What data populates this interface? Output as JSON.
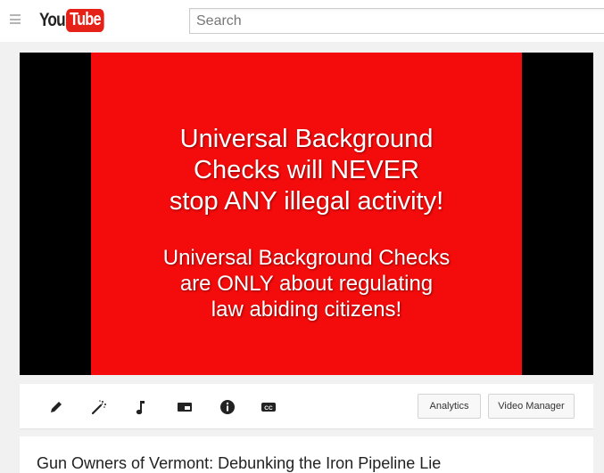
{
  "masthead": {
    "logo_you": "You",
    "logo_tube": "Tube",
    "search_placeholder": "Search"
  },
  "player": {
    "headline_lines": [
      "Universal Background",
      "Checks will NEVER",
      "stop ANY illegal activity!"
    ],
    "subline_lines": [
      "Universal Background Checks",
      "are ONLY about regulating",
      "law abiding citizens!"
    ],
    "slide_color": "#f40b0b"
  },
  "creator_bar": {
    "tools": [
      "pencil-icon",
      "magic-wand-icon",
      "music-note-icon",
      "card-icon",
      "info-icon",
      "cc-icon"
    ],
    "analytics_label": "Analytics",
    "video_manager_label": "Video Manager"
  },
  "video": {
    "title": "Gun Owners of Vermont: Debunking the Iron Pipeline Lie"
  }
}
